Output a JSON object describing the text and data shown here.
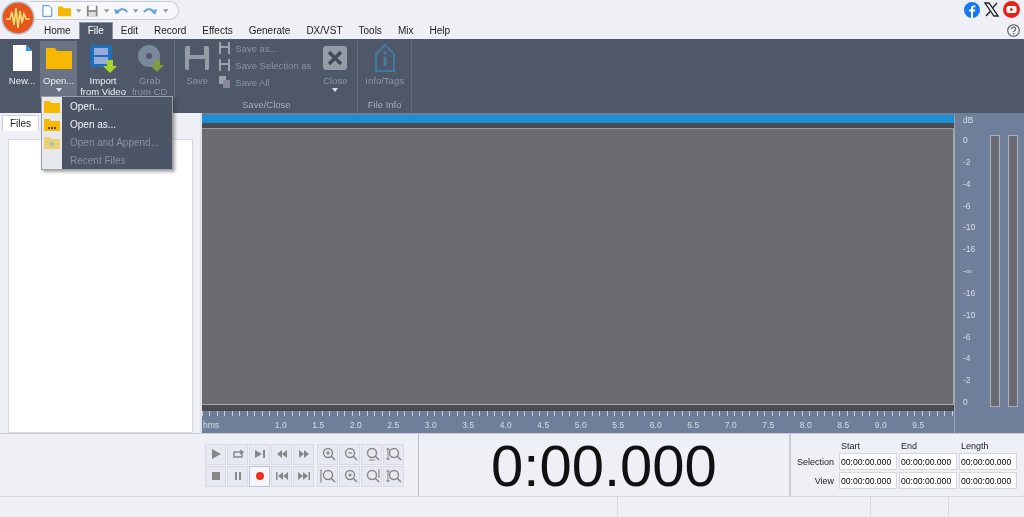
{
  "menu_tabs": [
    {
      "label": "Home",
      "selected": false
    },
    {
      "label": "File",
      "selected": true
    },
    {
      "label": "Edit",
      "selected": false
    },
    {
      "label": "Record",
      "selected": false
    },
    {
      "label": "Effects",
      "selected": false
    },
    {
      "label": "Generate",
      "selected": false
    },
    {
      "label": "DX/VST",
      "selected": false
    },
    {
      "label": "Tools",
      "selected": false
    },
    {
      "label": "Mix",
      "selected": false
    },
    {
      "label": "Help",
      "selected": false
    }
  ],
  "ribbon": {
    "groups": [
      {
        "buttons": [
          {
            "kind": "new",
            "label": "New...",
            "disabled": false,
            "selected": false,
            "dropdown": false
          },
          {
            "kind": "open",
            "label": "Open...",
            "disabled": false,
            "selected": true,
            "dropdown": true
          },
          {
            "kind": "import-video",
            "label": "Import\nfrom Video",
            "disabled": false,
            "selected": false,
            "dropdown": false
          },
          {
            "kind": "grab-cd",
            "label": "Grab\nfrom CD",
            "disabled": true,
            "selected": false,
            "dropdown": false
          }
        ]
      },
      {
        "label": "Save/Close",
        "buttons": [
          {
            "kind": "save",
            "label": "Save",
            "disabled": true,
            "selected": false,
            "dropdown": false
          },
          {
            "kind": "save-as",
            "label": "Save as...",
            "disabled": true,
            "selected": false,
            "dropdown": false
          },
          {
            "kind": "save-selection",
            "label": "Save Selection as",
            "disabled": true,
            "selected": false,
            "dropdown": false
          },
          {
            "kind": "save-all",
            "label": "Save All",
            "disabled": true,
            "selected": false,
            "dropdown": false
          },
          {
            "kind": "close",
            "label": "Close",
            "disabled": true,
            "selected": false,
            "dropdown": true
          }
        ]
      },
      {
        "label": "File Info",
        "buttons": [
          {
            "kind": "info",
            "label": "Info/Tags",
            "disabled": true,
            "selected": false,
            "dropdown": false
          }
        ]
      }
    ]
  },
  "open_menu": {
    "items": [
      {
        "kind": "folder",
        "label": "Open...",
        "disabled": false
      },
      {
        "kind": "folder-dots",
        "label": "Open as...",
        "disabled": false
      },
      {
        "kind": "folder-plus",
        "label": "Open and Append...",
        "disabled": true
      },
      {
        "kind": "text",
        "label": "Recent Files",
        "disabled": true
      }
    ]
  },
  "files_panel": {
    "tabs": [
      {
        "label": "Files",
        "selected": true
      }
    ]
  },
  "waveform": {
    "db_unit": "dB",
    "db_scale": [
      "0",
      "-2",
      "-4",
      "-6",
      "-10",
      "-16",
      "-∞",
      "-16",
      "-10",
      "-6",
      "-4",
      "-2",
      "0"
    ],
    "time_unit": "hms",
    "time_labels": [
      "1.0",
      "1.5",
      "2.0",
      "2.5",
      "3.0",
      "3.5",
      "4.0",
      "4.5",
      "5.0",
      "5.5",
      "6.0",
      "6.5",
      "7.0",
      "7.5",
      "8.0",
      "8.5",
      "9.0",
      "9.5"
    ]
  },
  "transport": [
    {
      "kind": "play"
    },
    {
      "kind": "loop"
    },
    {
      "kind": "play-to-end"
    },
    {
      "kind": "rewind"
    },
    {
      "kind": "fast-forward"
    },
    {
      "kind": "stop"
    },
    {
      "kind": "pause"
    },
    {
      "kind": "record"
    },
    {
      "kind": "go-start"
    },
    {
      "kind": "go-end"
    }
  ],
  "zoom": [
    {
      "kind": "zoom-in"
    },
    {
      "kind": "zoom-out"
    },
    {
      "kind": "zoom-full"
    },
    {
      "kind": "zoom-vertical"
    },
    {
      "kind": "zoom-left"
    },
    {
      "kind": "zoom-selection"
    },
    {
      "kind": "zoom-right"
    },
    {
      "kind": "zoom-vertical"
    }
  ],
  "time_display": "0:00.000",
  "selection": {
    "columns": [
      "Start",
      "End",
      "Length"
    ],
    "rows": [
      {
        "label": "Selection",
        "values": [
          "00:00:00.000",
          "00:00:00.000",
          "00:00:00.000"
        ]
      },
      {
        "label": "View",
        "values": [
          "00:00:00.000",
          "00:00:00.000",
          "00:00:00.000"
        ]
      }
    ]
  }
}
